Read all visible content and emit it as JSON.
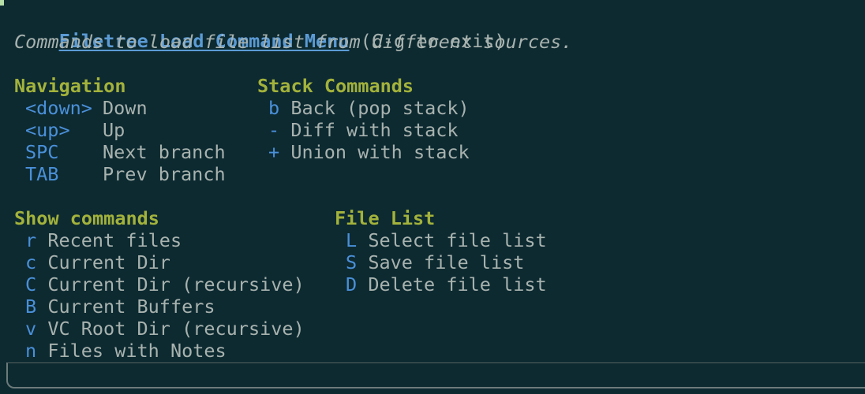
{
  "header": {
    "title": "Filetree Load Command Menu",
    "hint": "(C-g to exit)",
    "subtitle": "Commands to load file list from different sources."
  },
  "navigation": {
    "heading": "Navigation",
    "items": [
      {
        "key": "<down>",
        "label": "Down"
      },
      {
        "key": "<up>",
        "label": "Up"
      },
      {
        "key": "SPC",
        "label": "Next branch"
      },
      {
        "key": "TAB",
        "label": "Prev branch"
      }
    ]
  },
  "stack": {
    "heading": "Stack Commands",
    "items": [
      {
        "key": "b",
        "label": "Back (pop stack)"
      },
      {
        "key": "-",
        "label": "Diff with stack"
      },
      {
        "key": "+",
        "label": "Union with stack"
      }
    ]
  },
  "show": {
    "heading": "Show commands",
    "items": [
      {
        "key": "r",
        "label": "Recent files"
      },
      {
        "key": "c",
        "label": "Current Dir"
      },
      {
        "key": "C",
        "label": "Current Dir (recursive)"
      },
      {
        "key": "B",
        "label": "Current Buffers"
      },
      {
        "key": "v",
        "label": "VC Root Dir (recursive)"
      },
      {
        "key": "n",
        "label": "Files with Notes"
      }
    ]
  },
  "filelist": {
    "heading": "File List",
    "items": [
      {
        "key": "L",
        "label": "Select file list"
      },
      {
        "key": "S",
        "label": "Save file list"
      },
      {
        "key": "D",
        "label": "Delete file list"
      }
    ]
  },
  "colors": {
    "background": "#0d2a31",
    "heading": "#a3b23b",
    "key": "#4a90d9",
    "title": "#5b9bd5",
    "text": "#a8b2ae"
  }
}
